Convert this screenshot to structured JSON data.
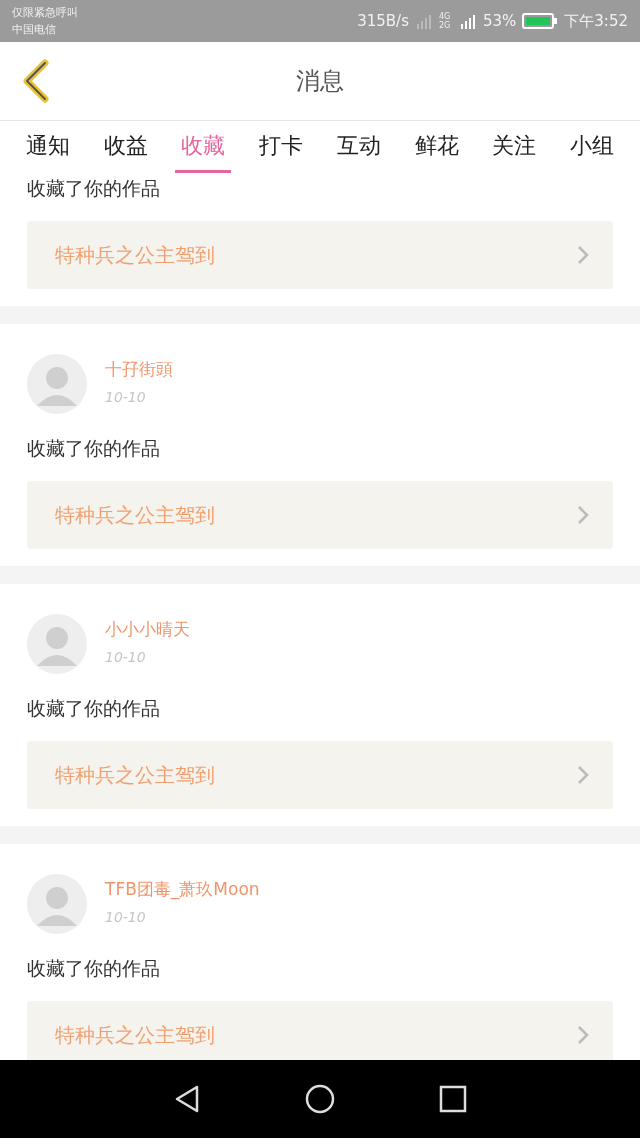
{
  "status_bar": {
    "notice": "仅限紧急呼叫",
    "carrier": "中国电信",
    "speed": "315B/s",
    "network": "4G 2G",
    "battery": "53%",
    "time": "下午3:52"
  },
  "header": {
    "title": "消息"
  },
  "tabs": [
    {
      "label": "通知",
      "selected": false
    },
    {
      "label": "收益",
      "selected": false
    },
    {
      "label": "收藏",
      "selected": true
    },
    {
      "label": "打卡",
      "selected": false
    },
    {
      "label": "互动",
      "selected": false
    },
    {
      "label": "鲜花",
      "selected": false
    },
    {
      "label": "关注",
      "selected": false
    },
    {
      "label": "小组",
      "selected": false
    }
  ],
  "messages": [
    {
      "kind": "partial",
      "text": "收藏了你的作品",
      "work": "特种兵之公主驾到"
    },
    {
      "kind": "full",
      "user": "十孖街頭",
      "date": "10-10",
      "text": "收藏了你的作品",
      "work": "特种兵之公主驾到"
    },
    {
      "kind": "full",
      "user": "小小小晴天",
      "date": "10-10",
      "text": "收藏了你的作品",
      "work": "特种兵之公主驾到"
    },
    {
      "kind": "full",
      "user": "TFB团毒_萧玖Moon",
      "date": "10-10",
      "text": "收藏了你的作品",
      "work": "特种兵之公主驾到"
    }
  ]
}
